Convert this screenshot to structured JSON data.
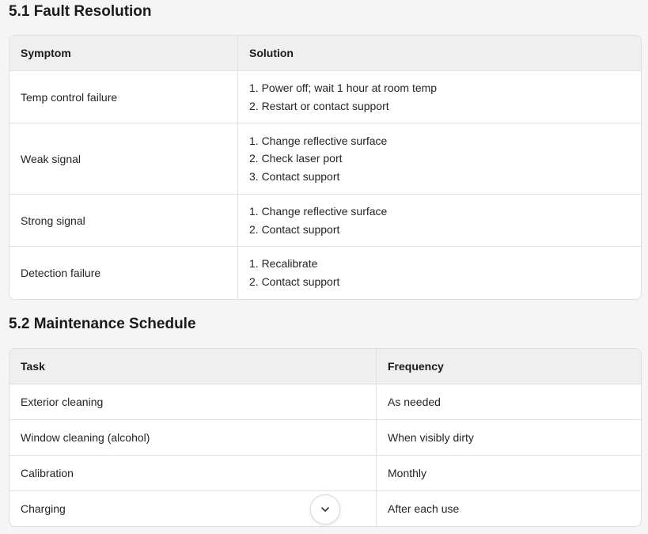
{
  "fault_section": {
    "title": "5.1 Fault Resolution",
    "headers": [
      "Symptom",
      "Solution"
    ],
    "rows": [
      {
        "symptom": "Temp control failure",
        "solutions": [
          "1. Power off; wait 1 hour at room temp",
          "2. Restart or contact support"
        ]
      },
      {
        "symptom": "Weak signal",
        "solutions": [
          "1. Change reflective surface",
          "2. Check laser port",
          "3. Contact support"
        ]
      },
      {
        "symptom": "Strong signal",
        "solutions": [
          "1. Change reflective surface",
          "2. Contact support"
        ]
      },
      {
        "symptom": "Detection failure",
        "solutions": [
          "1. Recalibrate",
          "2. Contact support"
        ]
      }
    ]
  },
  "maintenance_section": {
    "title": "5.2 Maintenance Schedule",
    "headers": [
      "Task",
      "Frequency"
    ],
    "rows": [
      {
        "task": "Exterior cleaning",
        "frequency": "As needed"
      },
      {
        "task": "Window cleaning (alcohol)",
        "frequency": "When visibly dirty"
      },
      {
        "task": "Calibration",
        "frequency": "Monthly"
      },
      {
        "task": "Charging",
        "frequency": "After each use"
      }
    ]
  },
  "scroll_button": {
    "icon": "chevron-down-icon"
  }
}
